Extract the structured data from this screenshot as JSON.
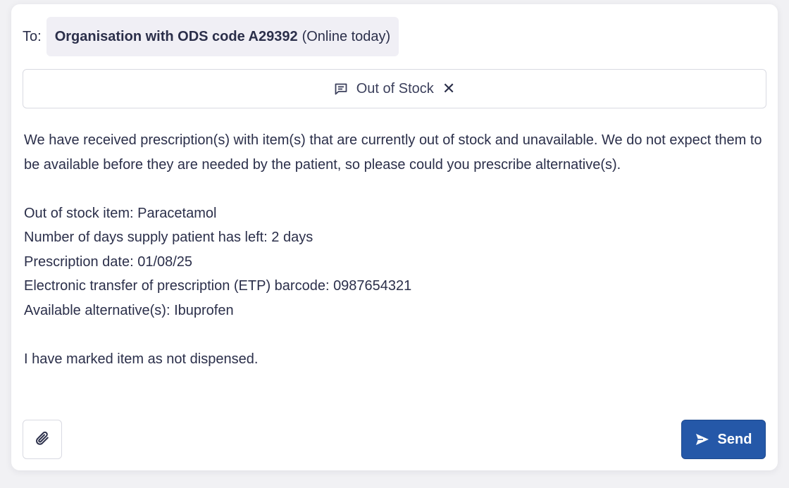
{
  "recipient": {
    "to_label": "To:",
    "organisation": "Organisation with ODS code A29392",
    "status": "(Online today)"
  },
  "topic": {
    "icon": "message-icon",
    "label": "Out of Stock",
    "close_icon": "close-icon",
    "close_glyph": "✕"
  },
  "message": {
    "intro": "We have received prescription(s) with item(s) that are currently out of stock and unavailable. We do not expect them to be available before they are needed by the patient, so please could you prescribe alternative(s).",
    "details": [
      "Out of stock item: Paracetamol",
      "Number of days supply patient has left: 2 days",
      "Prescription date: 01/08/25",
      "Electronic transfer of prescription (ETP) barcode: 0987654321",
      "Available alternative(s): Ibuprofen"
    ],
    "closing": "I have marked item as not dispensed."
  },
  "actions": {
    "attach_icon": "paperclip-icon",
    "send_label": "Send",
    "send_icon": "send-icon"
  },
  "colors": {
    "accent": "#2558a8",
    "text": "#2b2f4a",
    "chip_bg": "#f0eff5"
  }
}
